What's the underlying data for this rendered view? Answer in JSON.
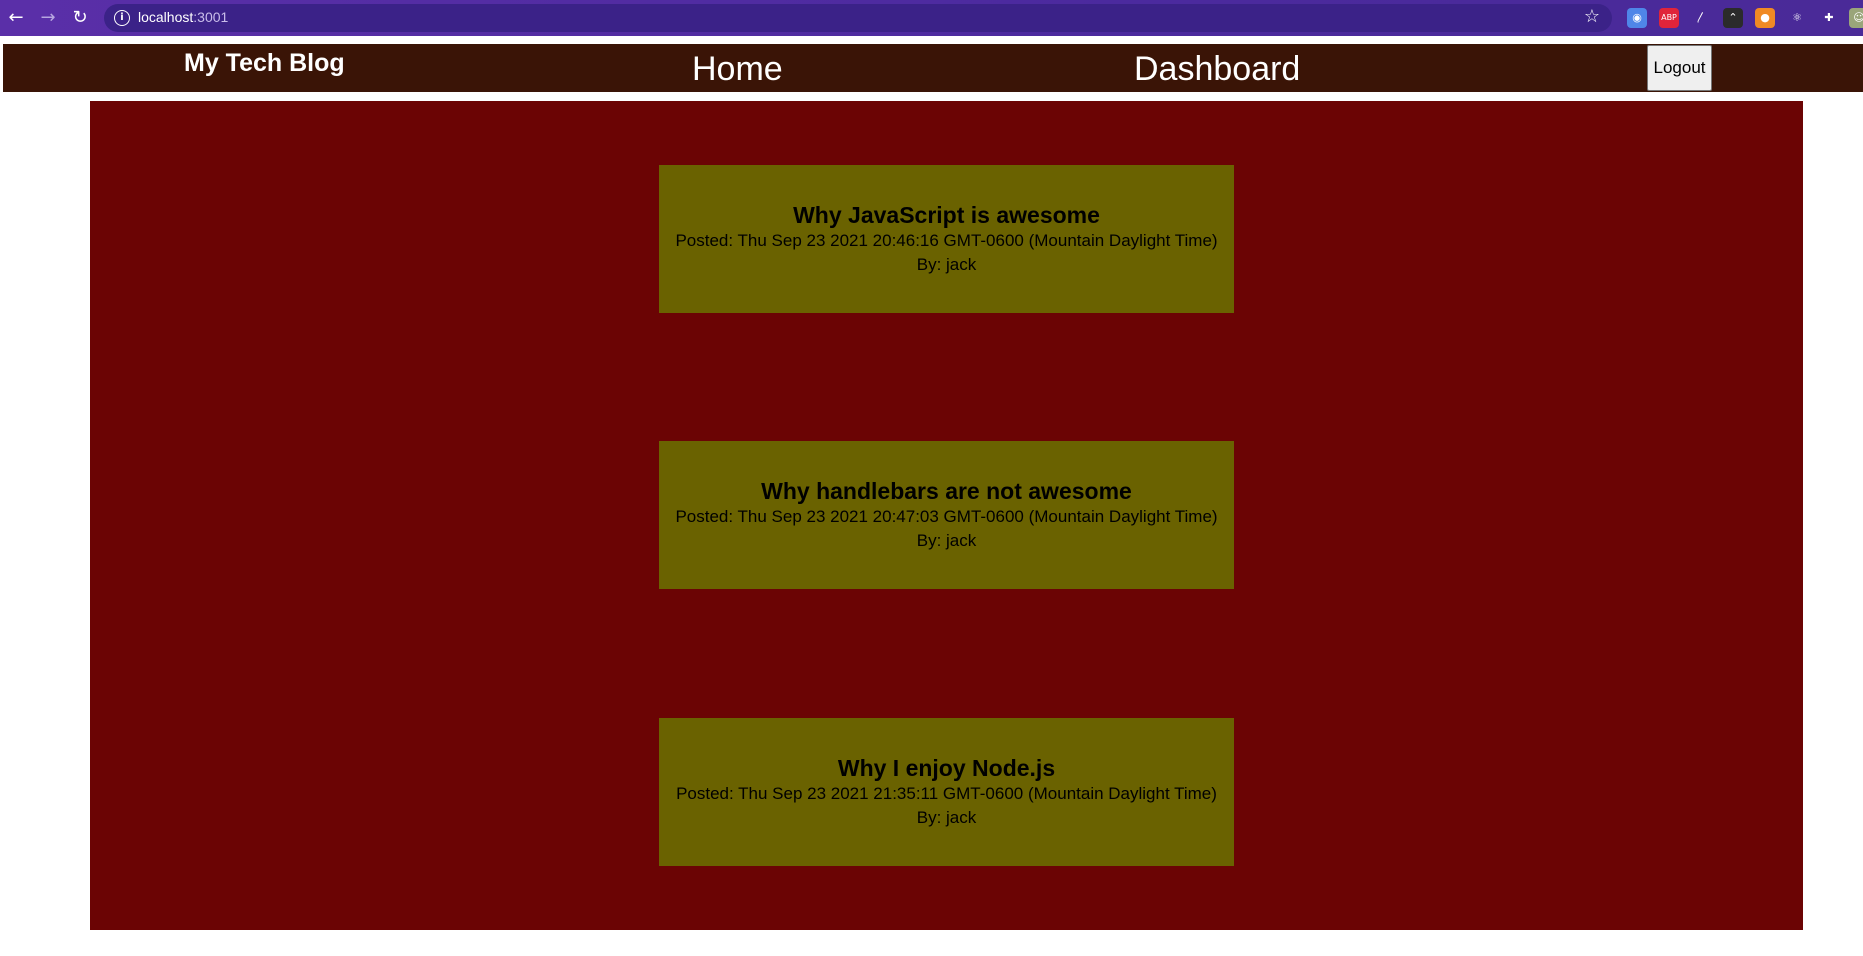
{
  "browser": {
    "url_host": "localhost",
    "url_port": ":3001",
    "back_glyph": "←",
    "forward_glyph": "→",
    "reload_glyph": "↻",
    "info_glyph": "i",
    "star_glyph": "☆",
    "extensions": [
      {
        "name": "camera-extension-icon",
        "glyph": "◉",
        "color": "#4f86e8"
      },
      {
        "name": "adblock-extension-icon",
        "glyph": "ABP",
        "color": "#e0243a"
      },
      {
        "name": "zigzag-extension-icon",
        "glyph": "〳",
        "color": "transparent"
      },
      {
        "name": "chevrons-extension-icon",
        "glyph": "⌃",
        "color": "#2b2b2b"
      },
      {
        "name": "honey-extension-icon",
        "glyph": "●",
        "color": "#f08a24"
      },
      {
        "name": "react-devtools-icon",
        "glyph": "⚛",
        "color": "transparent"
      },
      {
        "name": "extensions-puzzle-icon",
        "glyph": "✚",
        "color": "transparent"
      },
      {
        "name": "profile-avatar-icon",
        "glyph": "☺",
        "color": "#9aa57a"
      }
    ]
  },
  "nav": {
    "brand": "My Tech Blog",
    "home": "Home",
    "dashboard": "Dashboard",
    "logout": "Logout"
  },
  "posts": [
    {
      "title": "Why JavaScript is awesome",
      "posted": "Posted: Thu Sep 23 2021 20:46:16 GMT-0600 (Mountain Daylight Time)",
      "author": "By: jack"
    },
    {
      "title": "Why handlebars are not awesome",
      "posted": "Posted: Thu Sep 23 2021 20:47:03 GMT-0600 (Mountain Daylight Time)",
      "author": "By: jack"
    },
    {
      "title": "Why I enjoy Node.js",
      "posted": "Posted: Thu Sep 23 2021 21:35:11 GMT-0600 (Mountain Daylight Time)",
      "author": "By: jack"
    }
  ],
  "colors": {
    "nav_bg": "#3a1406",
    "main_bg": "#6b0404",
    "card_bg": "#6a6200"
  }
}
